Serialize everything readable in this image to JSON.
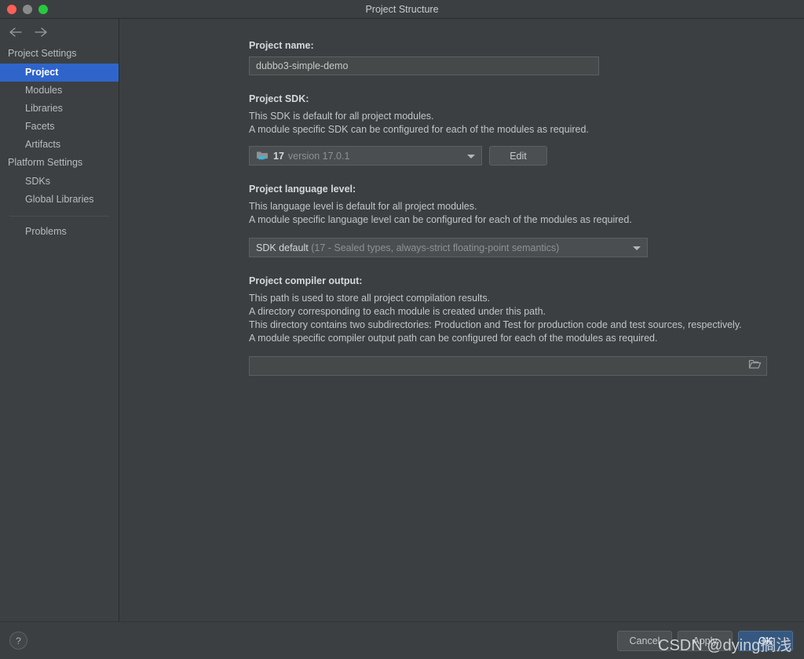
{
  "window": {
    "title": "Project Structure",
    "controls": {
      "close": "close",
      "minimize": "minimize",
      "maximize": "maximize"
    }
  },
  "sidebar": {
    "nav": {
      "back": "back-arrow",
      "forward": "forward-arrow"
    },
    "groups": [
      {
        "label": "Project Settings",
        "items": [
          {
            "label": "Project",
            "selected": true
          },
          {
            "label": "Modules",
            "selected": false
          },
          {
            "label": "Libraries",
            "selected": false
          },
          {
            "label": "Facets",
            "selected": false
          },
          {
            "label": "Artifacts",
            "selected": false
          }
        ]
      },
      {
        "label": "Platform Settings",
        "items": [
          {
            "label": "SDKs",
            "selected": false
          },
          {
            "label": "Global Libraries",
            "selected": false
          }
        ]
      }
    ],
    "extra": [
      {
        "label": "Problems",
        "selected": false
      }
    ]
  },
  "main": {
    "project_name": {
      "label": "Project name:",
      "value": "dubbo3-simple-demo",
      "placeholder": ""
    },
    "project_sdk": {
      "label": "Project SDK:",
      "desc_line1": "This SDK is default for all project modules.",
      "desc_line2": "A module specific SDK can be configured for each of the modules as required.",
      "selected_name": "17",
      "selected_version": "version 17.0.1",
      "icon": "jdk-folder-icon",
      "edit_label": "Edit"
    },
    "language_level": {
      "label": "Project language level:",
      "desc_line1": "This language level is default for all project modules.",
      "desc_line2": "A module specific language level can be configured for each of the modules as required.",
      "selected_primary": "SDK default",
      "selected_secondary": "(17 - Sealed types, always-strict floating-point semantics)"
    },
    "compiler_output": {
      "label": "Project compiler output:",
      "desc_line1": "This path is used to store all project compilation results.",
      "desc_line2": "A directory corresponding to each module is created under this path.",
      "desc_line3": "This directory contains two subdirectories: Production and Test for production code and test sources, respectively.",
      "desc_line4": "A module specific compiler output path can be configured for each of the modules as required.",
      "value": "",
      "placeholder": "",
      "browse_icon": "folder-icon"
    }
  },
  "footer": {
    "help_label": "?",
    "cancel_label": "Cancel",
    "apply_label": "Apply",
    "ok_label": "OK"
  },
  "watermark": {
    "text": "CSDN @dying搁浅"
  },
  "colors": {
    "background": "#3c3f41",
    "sidebar": "#3c4043",
    "selection": "#2f65cb",
    "primary_button": "#365880",
    "text": "#c2c5c7",
    "traffic_close": "#ff5f57",
    "traffic_min": "#8a8a8a",
    "traffic_max": "#28c840"
  }
}
